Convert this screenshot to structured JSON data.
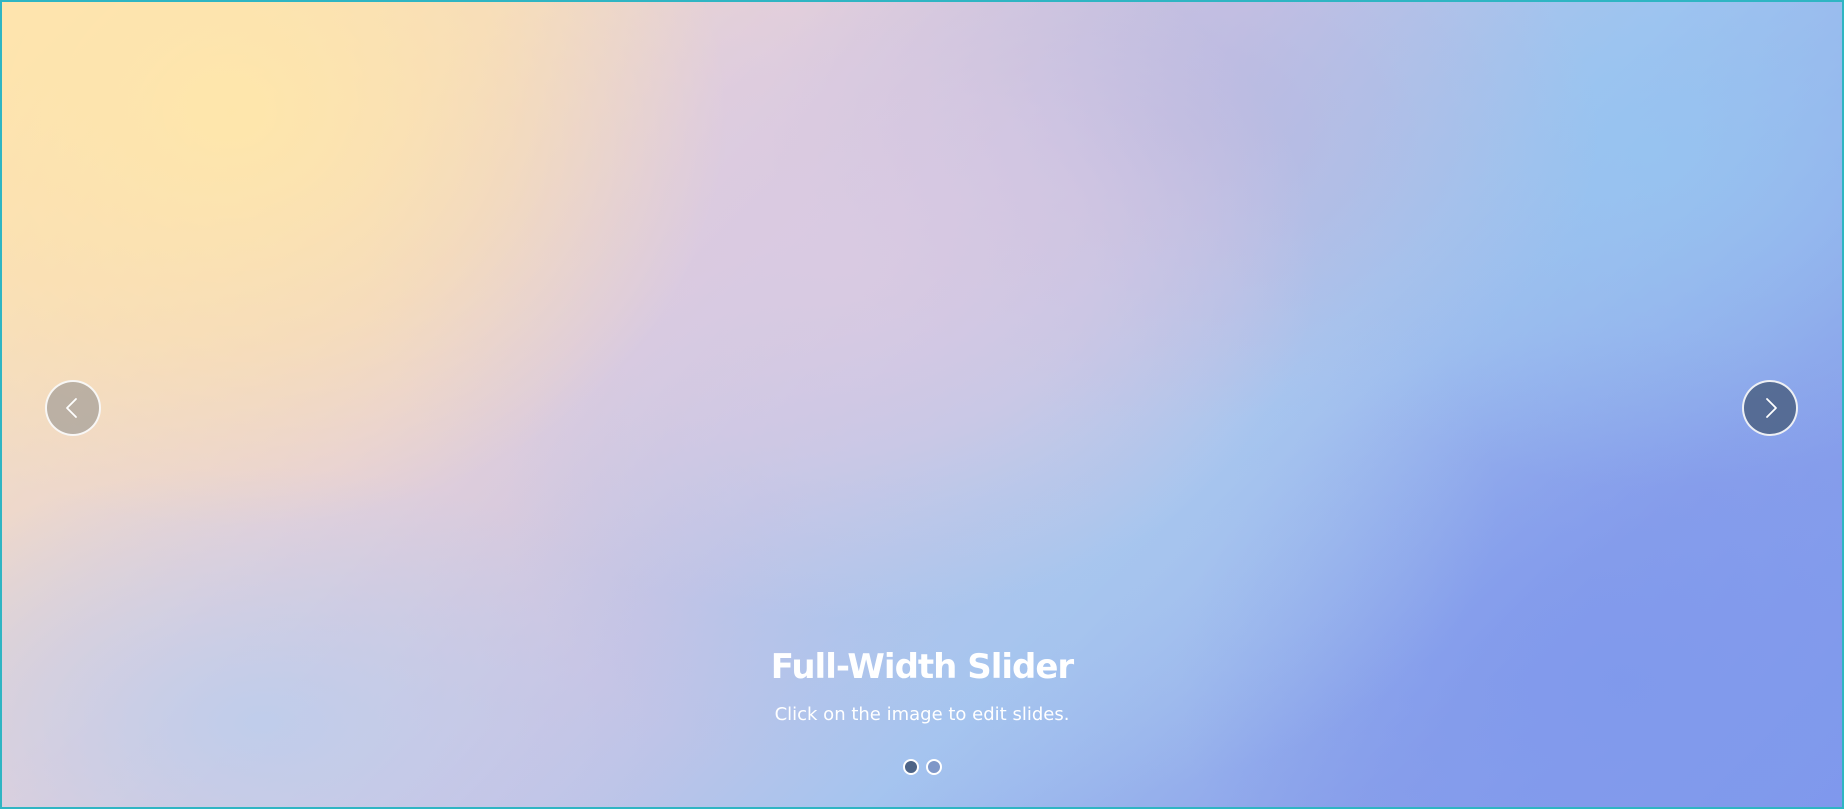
{
  "slider": {
    "title": "Full-Width Slider",
    "subtitle": "Click on the image to edit slides.",
    "prev_icon": "chevron-left-icon",
    "next_icon": "chevron-right-icon",
    "slide_count": 2,
    "active_slide": 1,
    "colors": {
      "frame_border": "#2fb5c3",
      "prev_button": "#8c8c8c",
      "next_button": "#50668c",
      "dot_active": "#4d6487",
      "dot_inactive": "#7f97c8"
    }
  }
}
